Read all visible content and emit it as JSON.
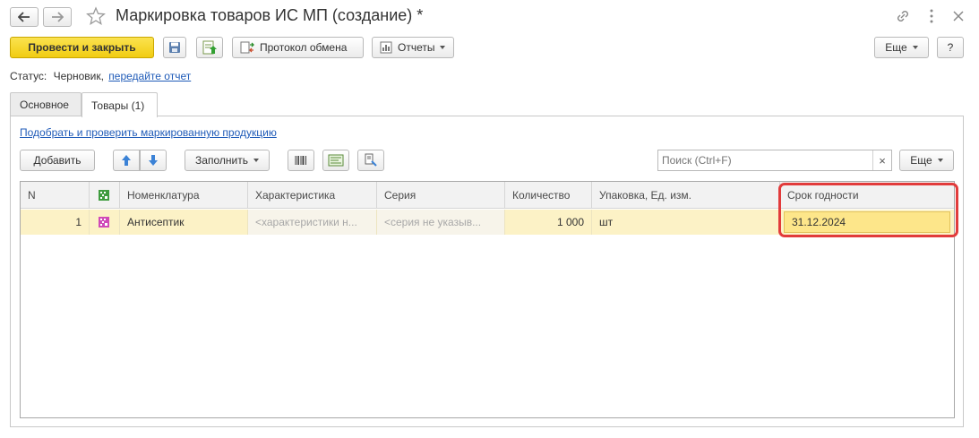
{
  "window": {
    "title": "Маркировка товаров ИС МП (создание) *"
  },
  "toolbar": {
    "post_close": "Провести и закрыть",
    "protocol": "Протокол обмена",
    "reports": "Отчеты",
    "more": "Еще",
    "help": "?"
  },
  "status": {
    "label": "Статус:",
    "value": "Черновик,",
    "link": "передайте отчет"
  },
  "tabs": [
    {
      "label": "Основное"
    },
    {
      "label": "Товары (1)"
    }
  ],
  "goods": {
    "pick_link": "Подобрать и проверить маркированную продукцию",
    "add": "Добавить",
    "fill": "Заполнить",
    "search_placeholder": "Поиск (Ctrl+F)",
    "clear": "×",
    "more": "Еще"
  },
  "table": {
    "columns": [
      "N",
      "Номенклатура",
      "Характеристика",
      "Серия",
      "Количество",
      "Упаковка, Ед. изм.",
      "Срок годности"
    ],
    "rows": [
      {
        "n": "1",
        "nomenclature": "Антисептик",
        "characteristic": "<характеристики н...",
        "series": "<серия не указыв...",
        "quantity": "1 000",
        "unit": "шт",
        "expiry": "31.12.2024"
      }
    ]
  },
  "colors": {
    "primary": "#f4d119",
    "selected_row": "#fcf2c6",
    "highlight_border": "#e23b3b",
    "link": "#1f5bb8"
  }
}
